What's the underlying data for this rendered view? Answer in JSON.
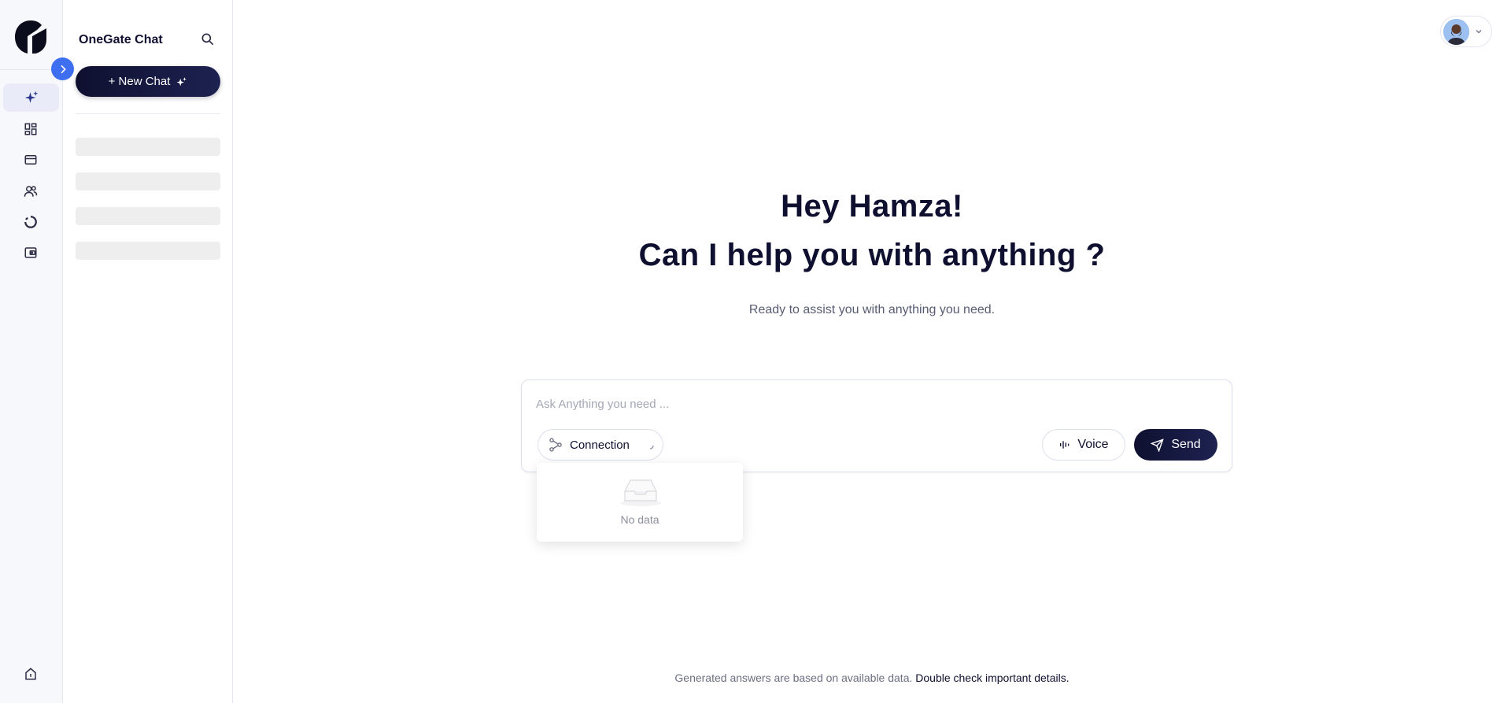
{
  "rail": {
    "logo_icon": "onegate-logo",
    "collapse_icon": "chevron-right-icon",
    "items": [
      {
        "icon": "sparkles-icon",
        "active": true
      },
      {
        "icon": "dashboard-icon",
        "active": false
      },
      {
        "icon": "card-icon",
        "active": false
      },
      {
        "icon": "users-icon",
        "active": false
      },
      {
        "icon": "donut-chart-icon",
        "active": false
      },
      {
        "icon": "wallet-icon",
        "active": false
      }
    ],
    "bottom_icon": "home-icon"
  },
  "panel": {
    "title": "OneGate Chat",
    "search_icon": "search-icon",
    "new_chat_label": "+ New Chat",
    "new_chat_icon": "sparkle-icon"
  },
  "header": {
    "avatar_icon": "user-avatar",
    "dropdown_icon": "chevron-down-icon"
  },
  "hero": {
    "greeting": "Hey Hamza!",
    "question": "Can I help you with anything ?",
    "subtitle": "Ready to assist you with anything you need."
  },
  "prompt": {
    "placeholder": "Ask Anything you need ...",
    "value": "",
    "connection_label": "Connection",
    "voice_label": "Voice",
    "send_label": "Send"
  },
  "dropdown": {
    "empty_text": "No data"
  },
  "footer": {
    "note": "Generated answers are based on available data.",
    "note_strong": "Double check important details."
  },
  "colors": {
    "brand_dark": "#0f1030",
    "accent_blue": "#3e6ff1",
    "rail_active_bg": "#e9ecf8"
  }
}
